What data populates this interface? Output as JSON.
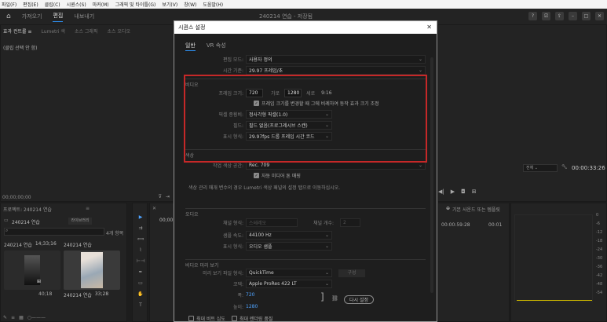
{
  "menu": [
    "파일(F)",
    "편집(E)",
    "클립(C)",
    "시퀀스(S)",
    "마커(M)",
    "그래픽 및 타이틀(G)",
    "보기(V)",
    "창(W)",
    "도움말(H)"
  ],
  "workspace": {
    "tabs": [
      "가져오기",
      "편집",
      "내보내기"
    ],
    "active": "편집",
    "doc_title": "240214 연습 - 저장됨"
  },
  "left_panel": {
    "tabs": [
      "효과 컨트롤 ≡",
      "Lumetri 색",
      "소스 그래픽",
      "소스 오디오"
    ],
    "content": "(클립 선택 안 함)",
    "timecode": "00;00;00;00"
  },
  "project_panel": {
    "title": "프로젝트: 240214 연습",
    "bin": "240214 연습",
    "item_count": "4개 항목",
    "search_placeholder": "",
    "clips": [
      {
        "name": "240214 연습",
        "dur": "14;33;16"
      },
      {
        "name": "240214 연습",
        "dur": "33;28"
      },
      {
        "name": "",
        "dur": "40;18"
      },
      {
        "name": "240214 연습",
        "dur": "33;28"
      }
    ]
  },
  "program_monitor": {
    "timecode": "00:00:33:26",
    "fit": "전체"
  },
  "timeline": {
    "label": "기본 사운드 또는 템플릿",
    "times": [
      "00:00:59:28",
      "00:01"
    ],
    "tc": "00;00"
  },
  "meter_scale": [
    "0",
    "-6",
    "-12",
    "-18",
    "-24",
    "-30",
    "-36",
    "-42",
    "-48",
    "-54"
  ],
  "dialog": {
    "title": "시퀀스 설정",
    "close": "✕",
    "tabs": [
      "일반",
      "VR 속성"
    ],
    "active_tab": "일반",
    "edit_mode_label": "편집 모드:",
    "edit_mode": "사용자 정의",
    "timebase_label": "시간 기준:",
    "timebase": "29.97 프레임/초",
    "video_section": "비디오",
    "frame_size_label": "프레임 크기:",
    "frame_w": "720",
    "w_label": "가로",
    "frame_h": "1280",
    "h_label": "세로",
    "ratio": "9:16",
    "scale_check": "프레임 크기를 변경할 때 그에 비례하여 동작 효과 크기 조정",
    "pixel_label": "픽셀 종횡비:",
    "pixel": "정사각형 픽셀(1.0)",
    "field_label": "필드:",
    "field": "필드 없음(프로그레시브 스캔)",
    "display_label": "표시 형식:",
    "display": "29.97fps 드롭 프레임 시간 코드",
    "color_section": "색상",
    "working_label": "작업 색상 공간:",
    "working": "Rec. 709",
    "auto_check": "자동 미디어 톤 매핑",
    "color_note": "색상 관리 매개 변수의 경우 Lumetri 색상 패널의 설정 탭으로 이동하십시오.",
    "audio_section": "오디오",
    "channel_label": "채널 형식:",
    "channel": "스테레오",
    "channel_count_label": "채널 개수:",
    "channel_count": "2",
    "sample_label": "샘플 속도:",
    "sample": "44100 Hz",
    "audio_display_label": "표시 형식:",
    "audio_display": "오디오 샘플",
    "preview_section": "비디오 미리 보기",
    "preview_format_label": "미리 보기 파일 형식:",
    "preview_format": "QuickTime",
    "config_button": "구성",
    "codec_label": "코덱:",
    "codec": "Apple ProRes 422 LT",
    "width_label": "폭:",
    "width": "720",
    "height_label": "높이:",
    "height": "1280",
    "reset_button": "다시 설정",
    "max_bit": "최대 비트 심도",
    "max_render": "최대 렌더링 품질"
  }
}
